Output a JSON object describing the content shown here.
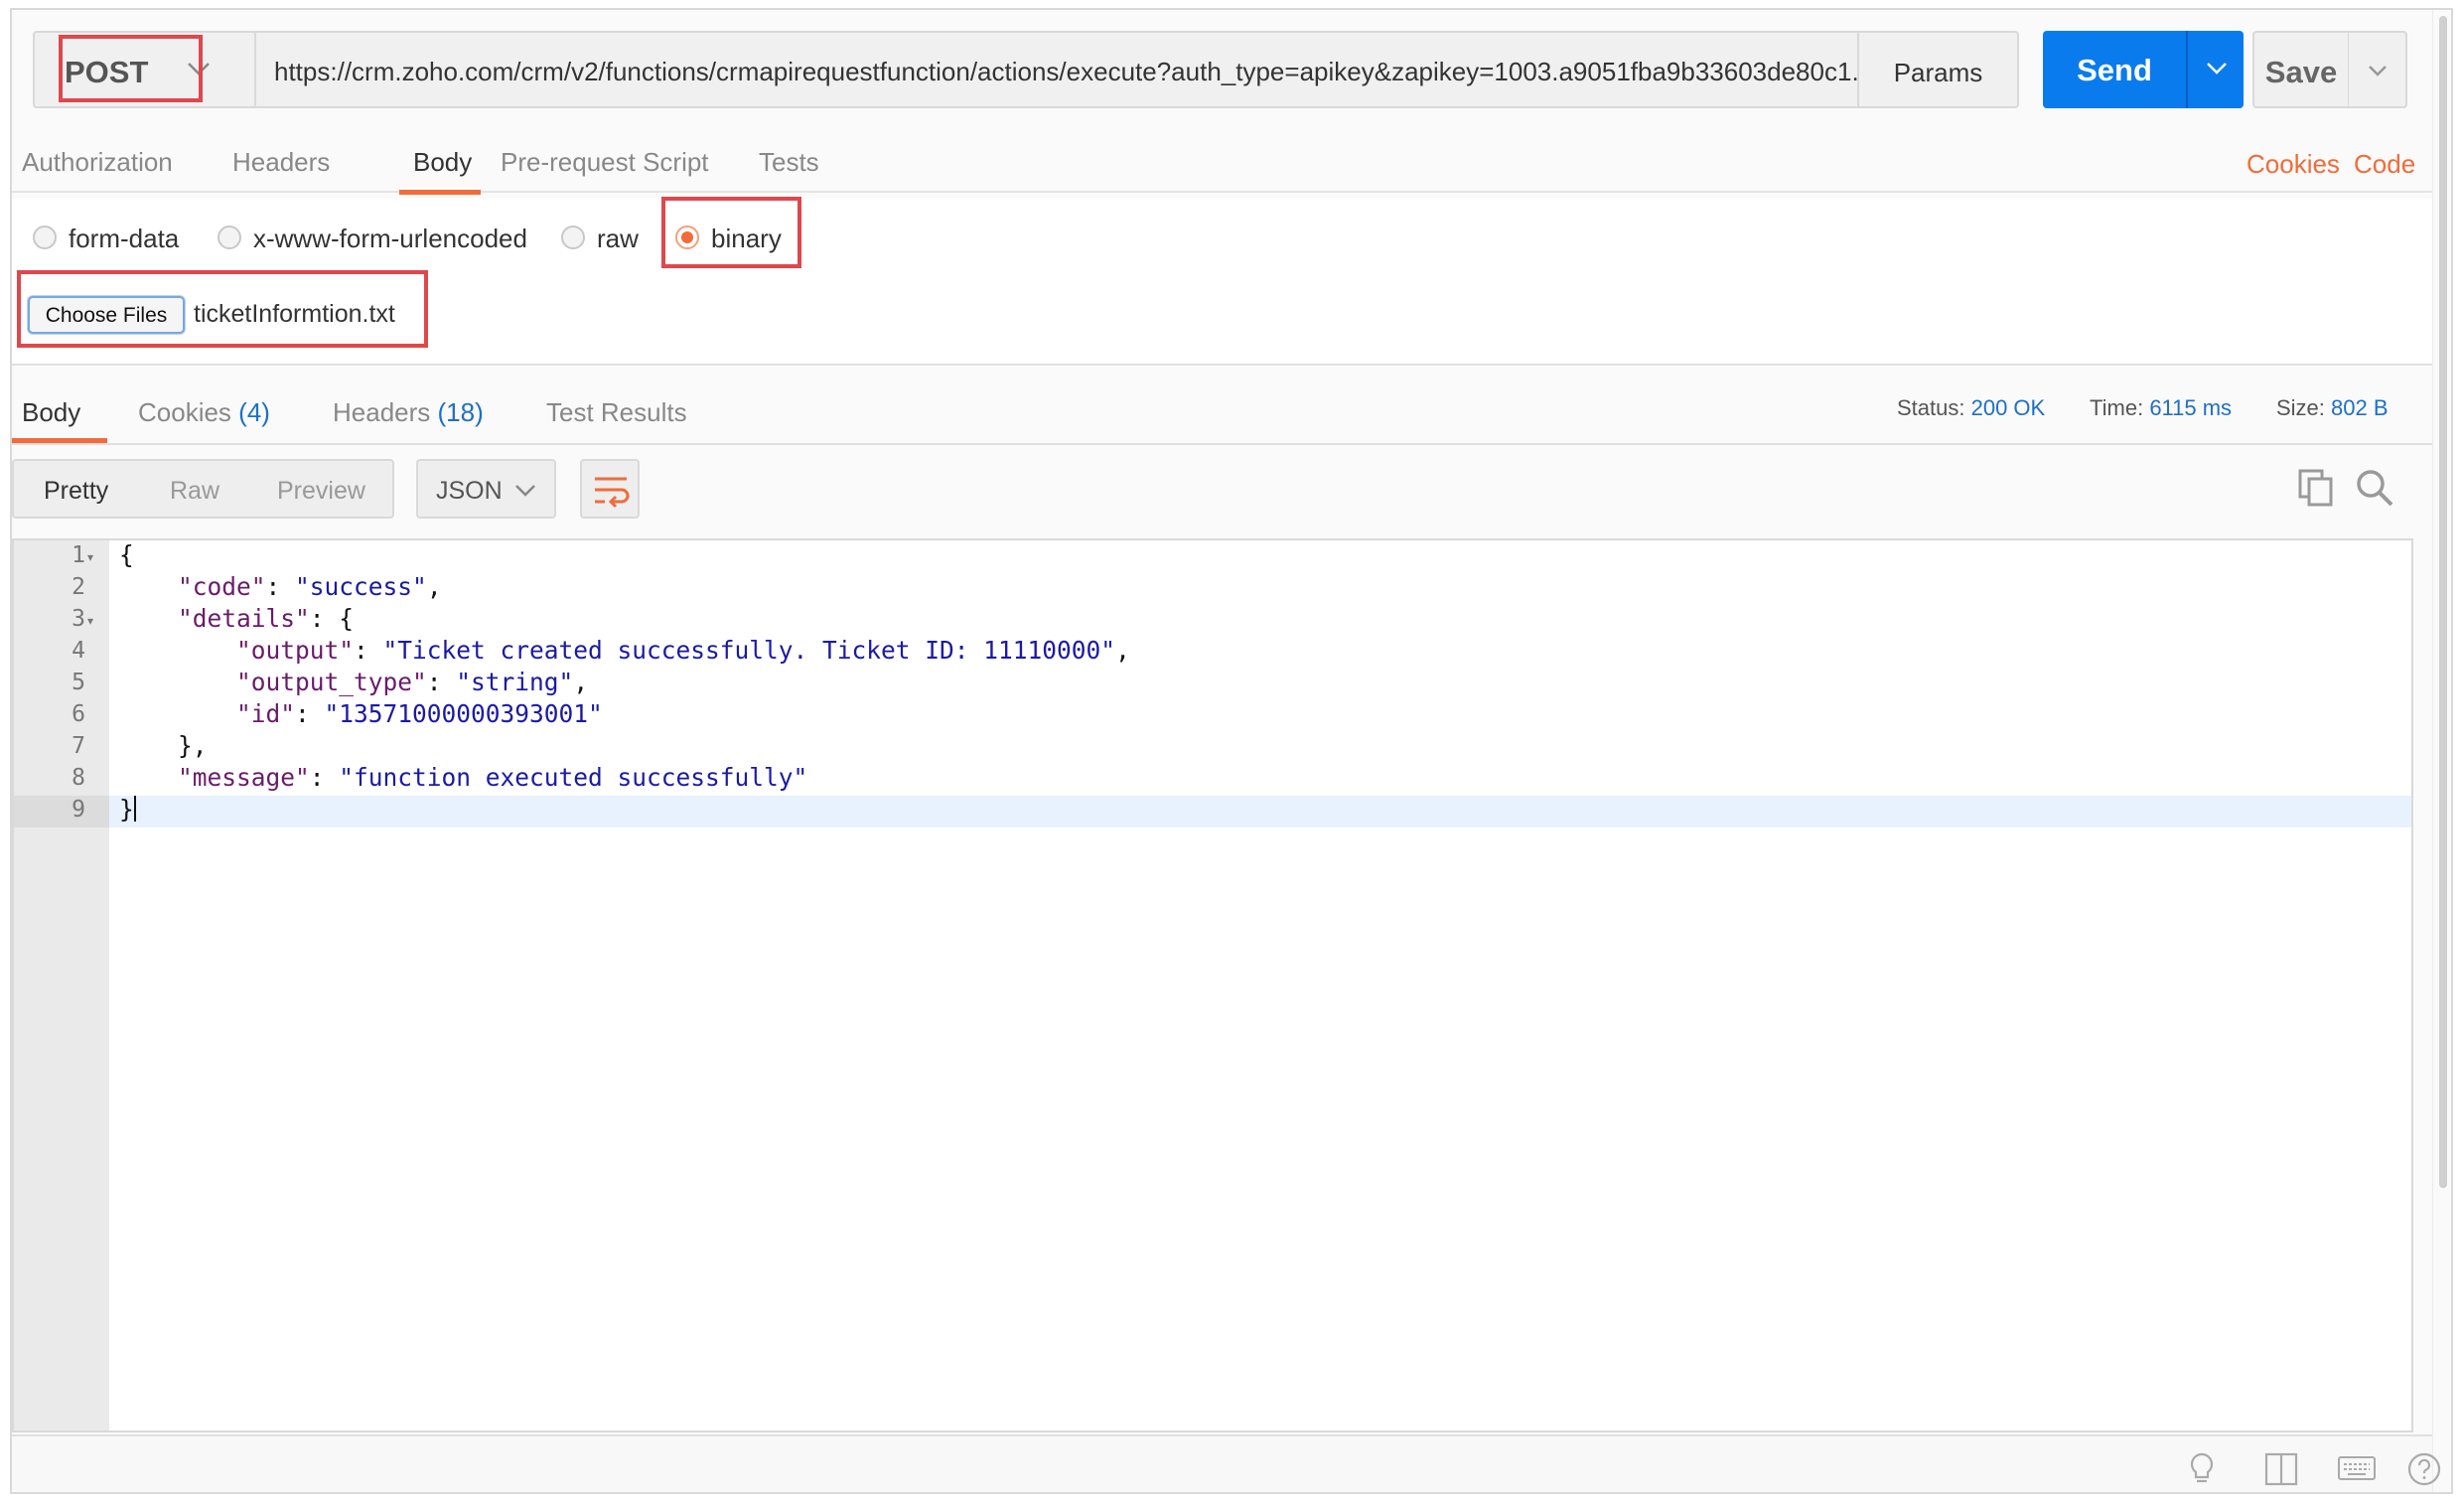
{
  "request": {
    "method": "POST",
    "url": "https://crm.zoho.com/crm/v2/functions/crmapirequestfunction/actions/execute?auth_type=apikey&zapikey=1003.a9051fba9b33603de80c1...",
    "params_label": "Params",
    "send_label": "Send",
    "save_label": "Save"
  },
  "request_tabs": [
    "Authorization",
    "Headers",
    "Body",
    "Pre-request Script",
    "Tests"
  ],
  "request_links": {
    "cookies": "Cookies",
    "code": "Code"
  },
  "body_types": [
    "form-data",
    "x-www-form-urlencoded",
    "raw",
    "binary"
  ],
  "body_type_selected": "binary",
  "file": {
    "button_label": "Choose Files",
    "name": "ticketInformtion.txt"
  },
  "response_tabs": {
    "body": "Body",
    "cookies": "Cookies",
    "cookies_count": "(4)",
    "headers": "Headers",
    "headers_count": "(18)",
    "test_results": "Test Results"
  },
  "status": {
    "status_label": "Status:",
    "status_value": "200 OK",
    "time_label": "Time:",
    "time_value": "6115 ms",
    "size_label": "Size:",
    "size_value": "802 B"
  },
  "view_modes": [
    "Pretty",
    "Raw",
    "Preview"
  ],
  "format": "JSON",
  "code": {
    "line_numbers": [
      "1",
      "2",
      "3",
      "4",
      "5",
      "6",
      "7",
      "8",
      "9"
    ],
    "lines": {
      "l1": "{",
      "l2_key": "\"code\"",
      "l2_val": "\"success\"",
      "l3_key": "\"details\"",
      "l4_key": "\"output\"",
      "l4_val": "\"Ticket created successfully. Ticket ID: 11110000\"",
      "l5_key": "\"output_type\"",
      "l5_val": "\"string\"",
      "l6_key": "\"id\"",
      "l6_val": "\"13571000000393001\"",
      "l7": "},",
      "l8_key": "\"message\"",
      "l8_val": "\"function executed successfully\"",
      "l9": "}"
    }
  },
  "colors": {
    "accent": "#f26b3a",
    "send": "#097bed",
    "highlight": "#e0474c",
    "link_blue": "#1f6fc5"
  },
  "icons": [
    "chevron-down-icon",
    "wrap-lines-icon",
    "copy-icon",
    "search-icon",
    "lightbulb-icon",
    "two-pane-icon",
    "keyboard-icon",
    "help-icon"
  ]
}
